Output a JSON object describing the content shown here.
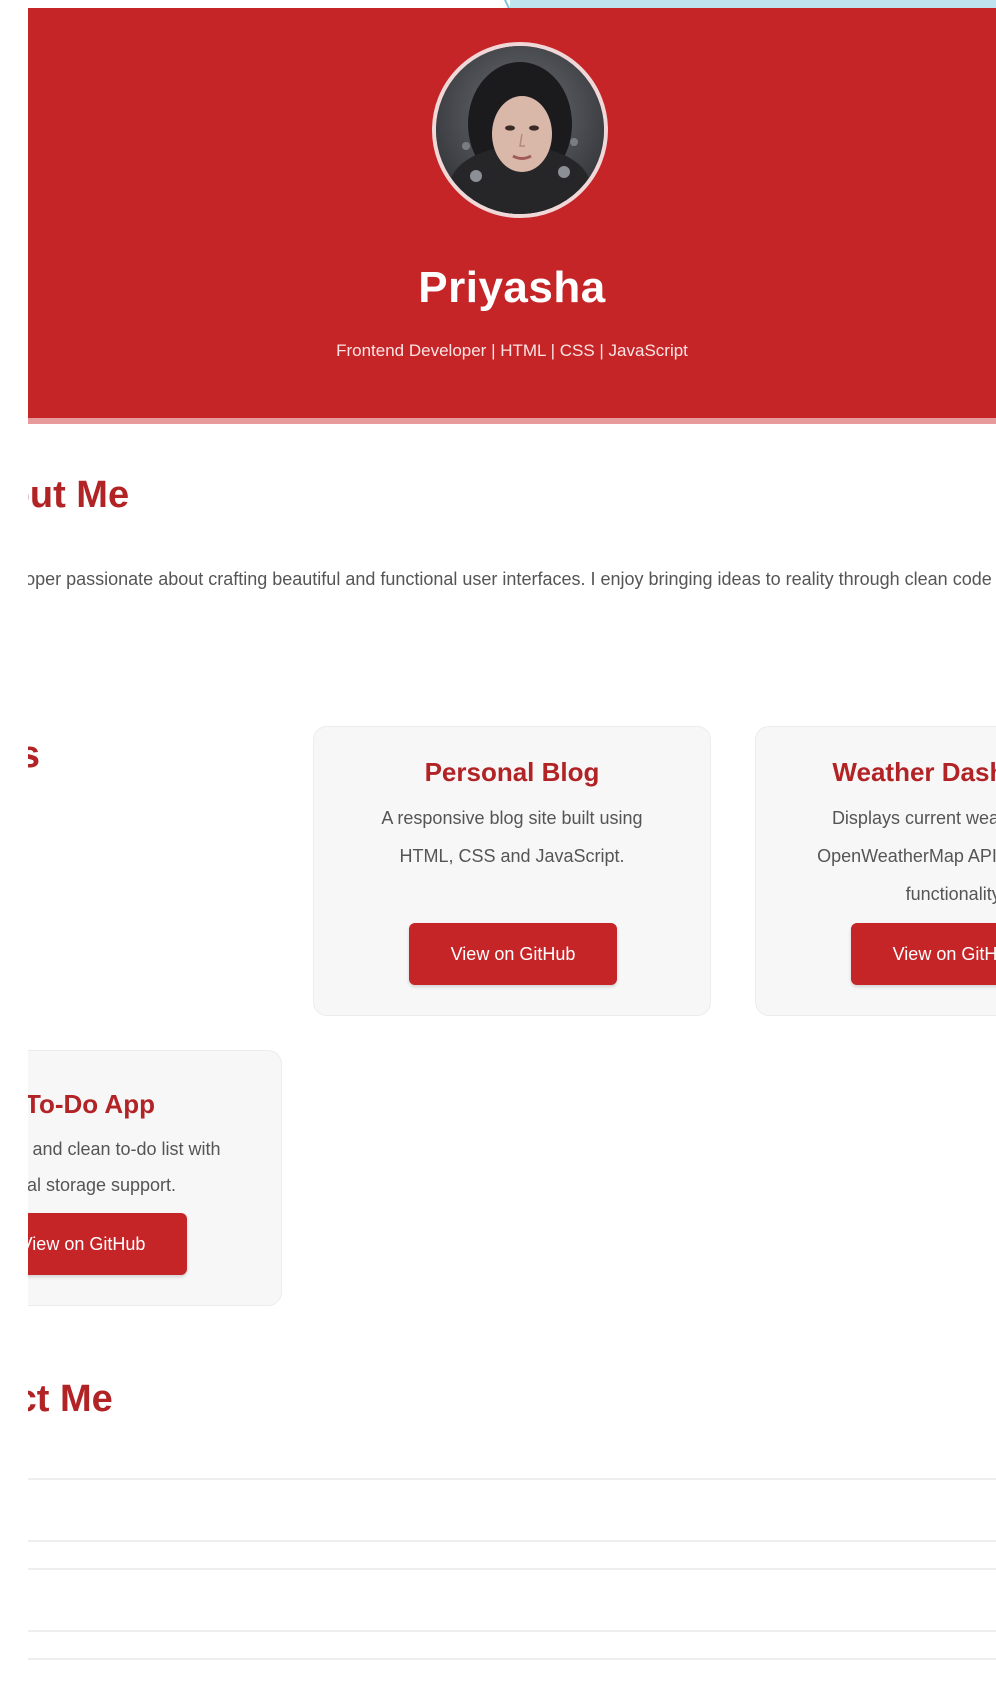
{
  "header": {
    "name": "Priyasha",
    "tagline": "Frontend Developer | HTML | CSS | JavaScript"
  },
  "about": {
    "title": "About Me",
    "text": "I am a frontend developer passionate about crafting beautiful and functional user interfaces. I enjoy bringing ideas to reality through clean code and responsive design."
  },
  "projects": {
    "title": "Projects",
    "items": [
      {
        "title": "Personal Blog",
        "description": "A responsive blog site built using HTML, CSS and JavaScript.",
        "button": "View on GitHub"
      },
      {
        "title": "Weather Dashboard",
        "description": "Displays current weather using OpenWeatherMap API with search functionality.",
        "button": "View on GitHub"
      },
      {
        "title": "To-Do App",
        "description": "A simple and clean to-do list with local storage support.",
        "button": "View on GitHub"
      }
    ]
  },
  "contact": {
    "title": "Contact Me"
  },
  "colors": {
    "primary": "#c62528",
    "heading": "#b22326",
    "card_bg": "#f7f7f7",
    "text": "#555555"
  }
}
